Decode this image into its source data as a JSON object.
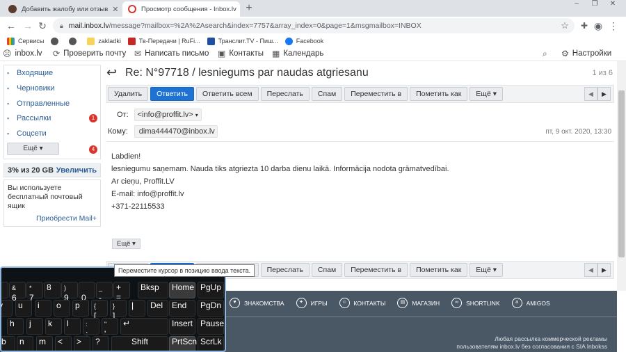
{
  "browser": {
    "tabs": [
      {
        "title": "Добавить жалобу или отзыв"
      },
      {
        "title": "Просмотр сообщения - Inbox.lv"
      }
    ],
    "url_host": "mail.inbox.lv",
    "url_path": "/message?mailbox=%2A%2Asearch&index=7757&array_index=0&page=1&msgmailbox=INBOX",
    "bookmarks": [
      "Сервисы",
      "zakladki",
      "Тв-Передачи | RuFi...",
      "Транслит.TV - Пиш...",
      "Facebook"
    ]
  },
  "mailnav": {
    "logo": "inbox.lv",
    "check": "Проверить почту",
    "compose": "Написать письмо",
    "contacts": "Контакты",
    "calendar": "Календарь",
    "settings": "Настройки"
  },
  "sidebar": {
    "folders": [
      {
        "label": "Входящие",
        "badge": ""
      },
      {
        "label": "Черновики",
        "badge": ""
      },
      {
        "label": "Отправленные",
        "badge": ""
      },
      {
        "label": "Рассылки",
        "badge": "1"
      },
      {
        "label": "Соцсети",
        "badge": ""
      }
    ],
    "more_label": "Ещё",
    "more_badge": "4",
    "quota_used": "3% из 20 GB",
    "quota_upgrade": "Увеличить",
    "promo_text": "Вы используете бесплатный почтовый ящик",
    "promo_link": "Приобрести Mail+"
  },
  "message": {
    "title": "Re: N°97718 / lesniegums par naudas atgriesanu",
    "page_count": "1 из 6",
    "actions": [
      "Удалить",
      "Ответить",
      "Ответить всем",
      "Переслать",
      "Спам",
      "Переместить в",
      "Пометить как",
      "Ещё"
    ],
    "from_label": "От:",
    "from": "<info@proffit.lv>",
    "to_label": "Кому:",
    "to": "dima444470@inbox.lv",
    "date": "пт, 9 окт. 2020, 13:30",
    "body_lines": [
      "Labdien!",
      "lesniegumu saņemam. Nauda tiks atgriezta 10 darba dienu laikā. Informācija nodota grāmatvedībai.",
      "Ar cieņu, Proffit.LV",
      "E-mail: info@proffit.lv",
      "+371-22115533"
    ],
    "more_label": "Ещё"
  },
  "footer": {
    "nav": [
      "ЗНАКОМСТВА",
      "ИГРЫ",
      "КОНТАКТЫ",
      "МАГАЗИН",
      "SHORTLINK",
      "AMIGOS"
    ],
    "note_1": "Любая рассылка коммерческой рекламы",
    "note_2": "пользователям inbox.lv без согласования с SIA Inbokss"
  },
  "keyboard": {
    "tooltip": "Переместите курсор в позицию ввода текста.",
    "row1": [
      "^",
      "6",
      "7",
      "8",
      "9",
      "0",
      "-",
      "+",
      "Bksp",
      "Home",
      "PgUp"
    ],
    "row1_sub": [
      "",
      "&",
      "*",
      "(",
      ")",
      "",
      "_",
      "=",
      "",
      "",
      ""
    ],
    "row2": [
      "y",
      "u",
      "i",
      "o",
      "p",
      "[",
      "]",
      "|",
      "Del",
      "End",
      "PgDn"
    ],
    "row2_sub": [
      "",
      "",
      "",
      "",
      "",
      "{",
      "}",
      "\\",
      "",
      "",
      ""
    ],
    "row3": [
      "h",
      "j",
      "k",
      "l",
      ";",
      "'",
      "↵",
      "Insert",
      "Pause"
    ],
    "row3_sub": [
      "",
      "",
      "",
      "",
      ":",
      "\"",
      "",
      "",
      ""
    ],
    "row4": [
      "b",
      "n",
      "m",
      "<",
      ">",
      "?",
      "Shift",
      "PrtScn",
      "ScrLk"
    ],
    "row4_sub": [
      "",
      "",
      "",
      ",",
      ".",
      "/",
      "",
      "",
      ""
    ]
  }
}
